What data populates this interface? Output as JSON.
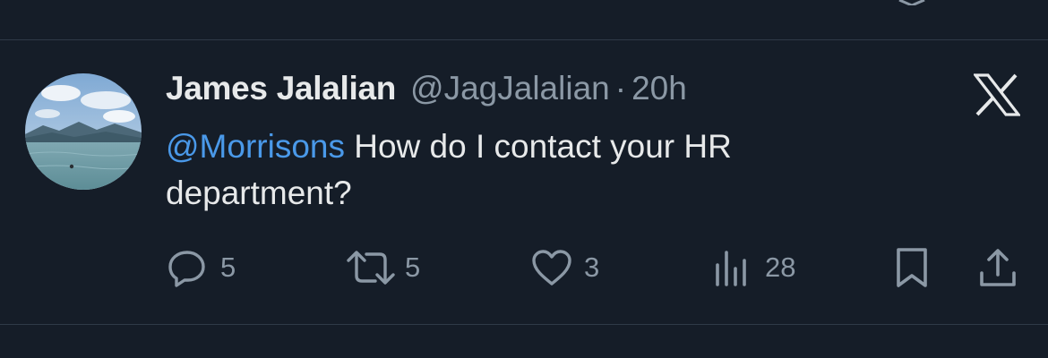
{
  "tweet": {
    "author_name": "James Jalalian",
    "handle": "@JagJalalian",
    "separator": "·",
    "timestamp": "20h",
    "mention": "@Morrisons",
    "text": " How do I contact your HR department?",
    "avatar_icon": "landscape-lake-avatar",
    "platform_icon": "x-logo-icon"
  },
  "actions": {
    "replies": "5",
    "reposts": "5",
    "likes": "3",
    "views": "28",
    "bookmark_icon": "bookmark-icon",
    "share_icon": "share-icon"
  },
  "colors": {
    "background": "#151d28",
    "primary_text": "#e7e9ea",
    "secondary_text": "#8b98a5",
    "link": "#4a99e9",
    "divider": "#2f3a47"
  }
}
